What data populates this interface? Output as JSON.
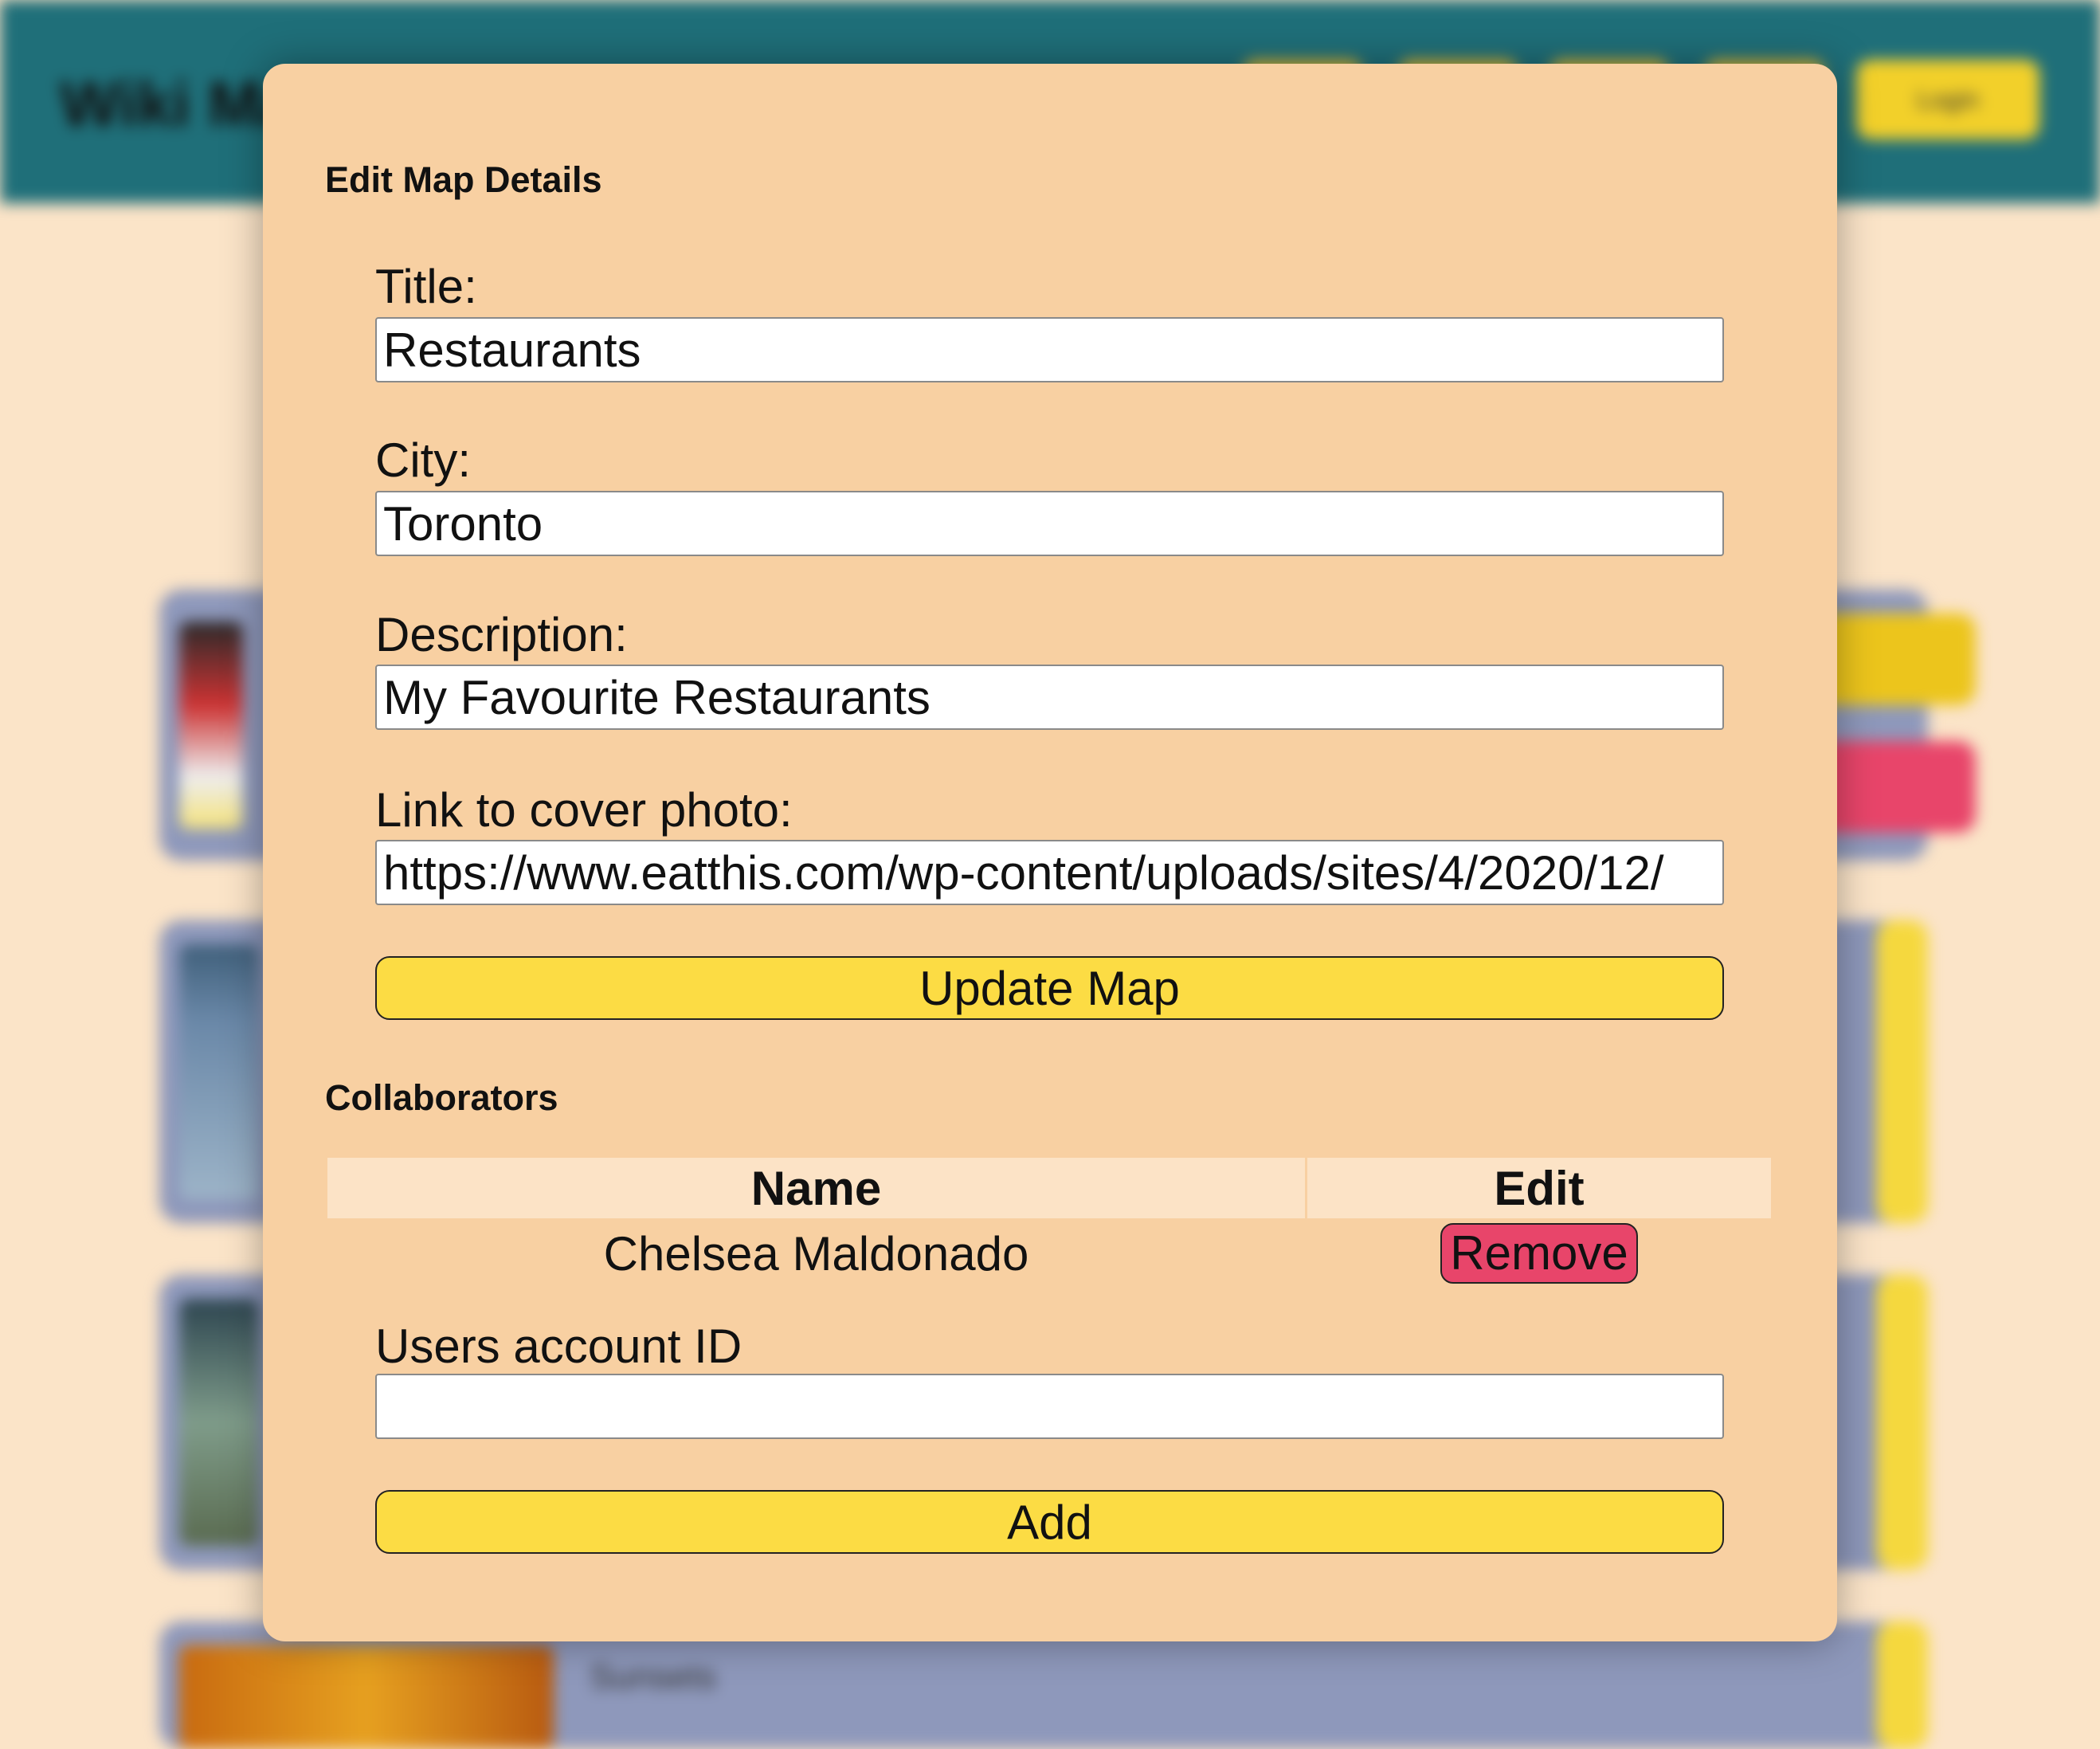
{
  "background": {
    "logo": "Wiki Maps",
    "login_label": "Login",
    "card_title": "Sunsets"
  },
  "modal": {
    "heading": "Edit Map Details",
    "fields": {
      "title_label": "Title:",
      "title_value": "Restaurants",
      "city_label": "City:",
      "city_value": "Toronto",
      "description_label": "Description:",
      "description_value": "My Favourite Restaurants",
      "cover_label": "Link to cover photo:",
      "cover_value": "https://www.eatthis.com/wp-content/uploads/sites/4/2020/12/"
    },
    "update_button": "Update Map",
    "collaborators": {
      "heading": "Collaborators",
      "columns": [
        "Name",
        "Edit"
      ],
      "rows": [
        {
          "name": "Chelsea Maldonado",
          "action": "Remove"
        }
      ],
      "account_label": "Users account ID",
      "account_value": "",
      "add_button": "Add"
    }
  },
  "colors": {
    "modal_bg": "#f8d0a2",
    "header_bg": "#1f6f79",
    "button_yellow": "#fcdc44",
    "remove_red": "#e8456a"
  }
}
